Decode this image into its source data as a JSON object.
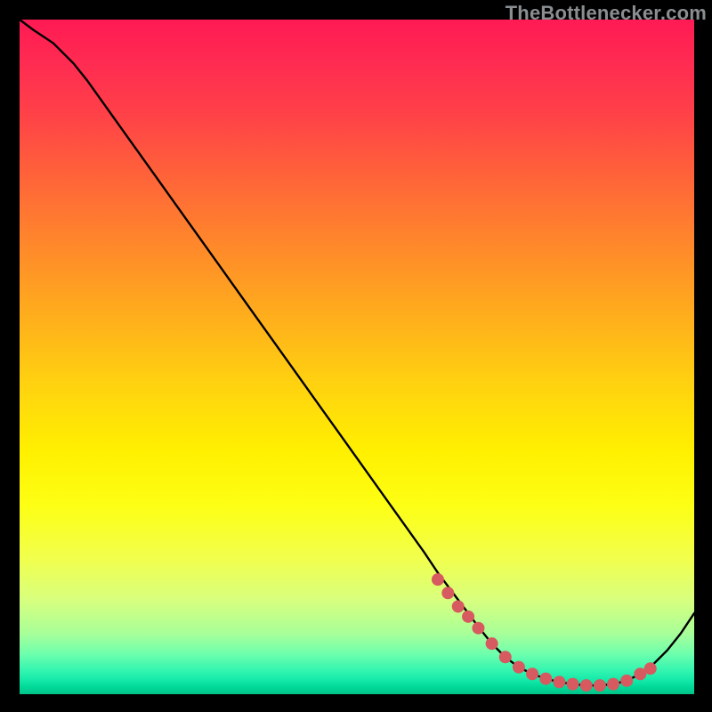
{
  "attribution": "TheBottlenecker.com",
  "chart_data": {
    "type": "line",
    "title": "",
    "xlabel": "",
    "ylabel": "",
    "xlim": [
      0,
      100
    ],
    "ylim": [
      0,
      100
    ],
    "x": [
      0,
      2,
      5,
      8,
      10,
      15,
      20,
      25,
      30,
      35,
      40,
      45,
      50,
      55,
      60,
      62,
      65,
      68,
      70,
      72,
      74,
      76,
      78,
      80,
      82,
      84,
      86,
      88,
      90,
      92,
      94,
      96,
      98,
      100
    ],
    "values": [
      100,
      98.5,
      96.5,
      93.5,
      91,
      84,
      77,
      70,
      63,
      56,
      49,
      42,
      35,
      28,
      21,
      18,
      14,
      10,
      7.5,
      5.5,
      4,
      3,
      2.3,
      1.8,
      1.5,
      1.3,
      1.3,
      1.5,
      2,
      3,
      4.5,
      6.5,
      9,
      12
    ],
    "marker_points": {
      "x": [
        62,
        63.5,
        65,
        66.5,
        68,
        70,
        72,
        74,
        76,
        78,
        80,
        82,
        84,
        86,
        88,
        90,
        92,
        93.5
      ],
      "y": [
        17,
        15,
        13,
        11.5,
        9.8,
        7.5,
        5.5,
        4,
        3,
        2.3,
        1.8,
        1.5,
        1.3,
        1.3,
        1.5,
        2,
        3,
        3.8
      ]
    },
    "colors": {
      "line": "#000000",
      "markers": "#d65a5f",
      "gradient_top": "#ff1a53",
      "gradient_mid": "#fff000",
      "gradient_bottom": "#00c388"
    }
  },
  "icons": {}
}
